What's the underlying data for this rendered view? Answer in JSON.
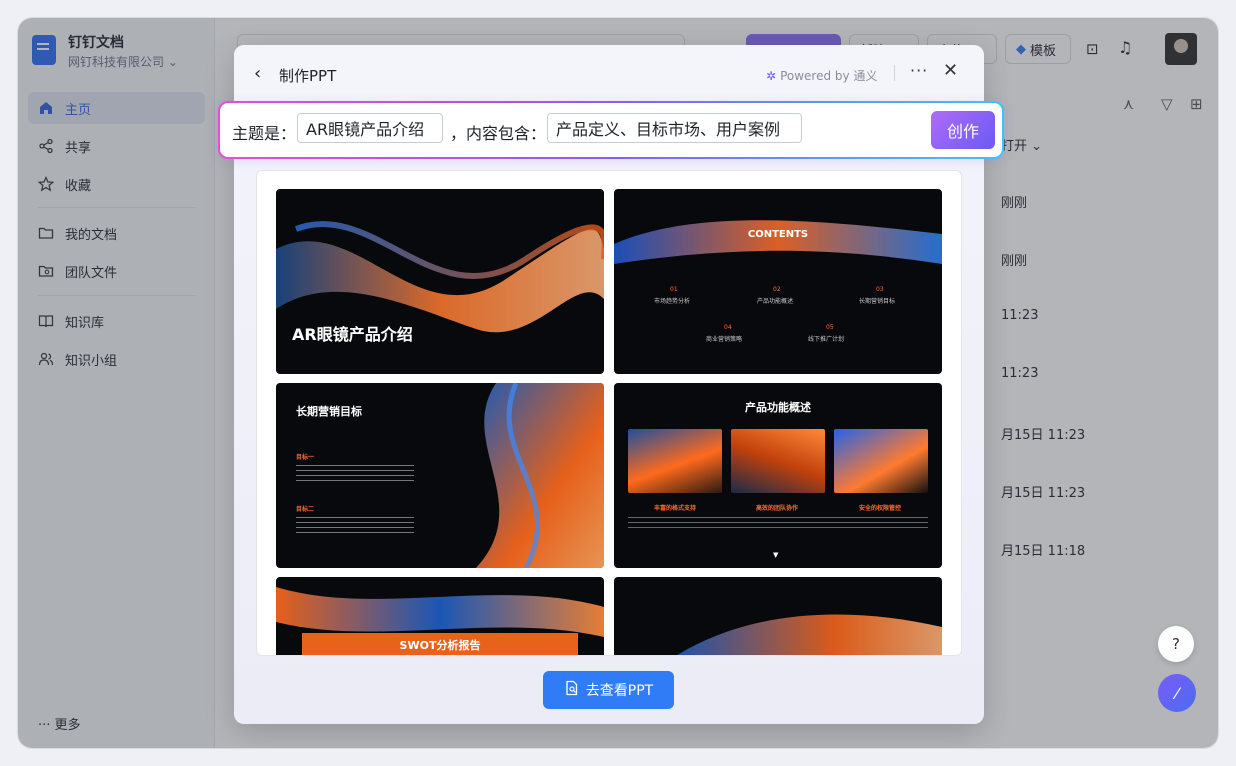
{
  "app": {
    "title": "钉钉文档",
    "org": "网钉科技有限公司"
  },
  "sidebar": {
    "items": [
      {
        "label": "主页",
        "icon": "home-icon"
      },
      {
        "label": "共享",
        "icon": "share-icon"
      },
      {
        "label": "收藏",
        "icon": "star-icon"
      },
      {
        "label": "我的文档",
        "icon": "folder-icon"
      },
      {
        "label": "团队文件",
        "icon": "team-folder-icon"
      },
      {
        "label": "知识库",
        "icon": "book-icon"
      },
      {
        "label": "知识小组",
        "icon": "group-icon"
      }
    ],
    "more": "更多"
  },
  "header": {
    "new_label": "新建",
    "upload_label": "上传",
    "template_label": "模板"
  },
  "background_list": {
    "sort_label": "打开",
    "rows": [
      "刚刚",
      "刚刚",
      "11:23",
      "11:23",
      "月15日 11:23",
      "月15日 11:23",
      "月15日 11:18"
    ]
  },
  "modal": {
    "title": "制作PPT",
    "powered_by": "Powered by 通义",
    "prompt": {
      "topic_label": "主题是：",
      "topic_value": "AR眼镜产品介绍",
      "content_label": "，内容包含：",
      "content_value": "产品定义、目标市场、用户案例",
      "create_label": "创作"
    },
    "slides": {
      "s1_title": "AR眼镜产品介绍",
      "s2_title": "CONTENTS",
      "s2_items": [
        {
          "num": "01",
          "label": "市场趋势分析"
        },
        {
          "num": "02",
          "label": "产品功能概述"
        },
        {
          "num": "03",
          "label": "长期营销目标"
        },
        {
          "num": "04",
          "label": "商业营销策略"
        },
        {
          "num": "05",
          "label": "线下推广计划"
        }
      ],
      "s3_title": "长期营销目标",
      "s3_sub1": "目标一",
      "s3_sub2": "目标二",
      "s4_title": "产品功能概述",
      "s4_cols": [
        "丰富的格式支持",
        "高效的团队协作",
        "安全的权限管控"
      ],
      "s5_title": "SWOT分析报告"
    },
    "cta_label": "去查看PPT"
  },
  "colors": {
    "accent": "#2f7cf6",
    "create_start": "#b06bf7",
    "create_end": "#6a5af5",
    "slide_orange": "#ff6b2c"
  }
}
